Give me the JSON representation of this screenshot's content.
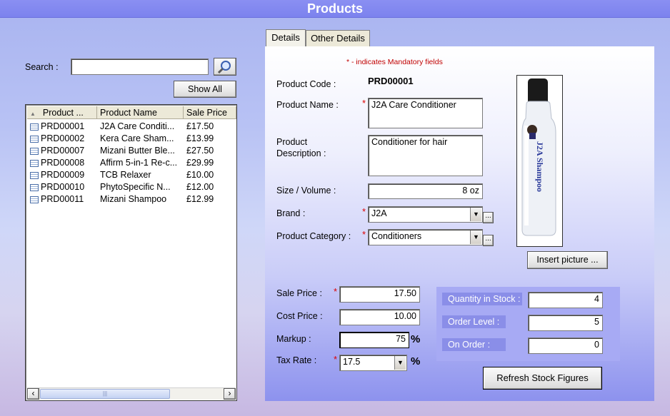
{
  "window": {
    "title": "Products"
  },
  "search": {
    "label": "Search :",
    "value": "",
    "show_all": "Show All"
  },
  "list": {
    "headers": [
      "Product ...",
      "Product Name",
      "Sale Price"
    ],
    "rows": [
      {
        "code": "PRD00001",
        "name": "J2A Care Conditi...",
        "price": "£17.50"
      },
      {
        "code": "PRD00002",
        "name": "Kera Care Sham...",
        "price": "£13.99"
      },
      {
        "code": "PRD00007",
        "name": "Mizani Butter Ble...",
        "price": "£27.50"
      },
      {
        "code": "PRD00008",
        "name": "Affirm 5-in-1 Re-c...",
        "price": "£29.99"
      },
      {
        "code": "PRD00009",
        "name": "TCB Relaxer",
        "price": "£10.00"
      },
      {
        "code": "PRD00010",
        "name": "PhytoSpecific N...",
        "price": "£12.00"
      },
      {
        "code": "PRD00011",
        "name": "Mizani Shampoo",
        "price": "£12.99"
      }
    ],
    "sort_glyph": "▲",
    "scroll_left": "‹",
    "scroll_right": "›",
    "scroll_grip": "|||"
  },
  "tabs": {
    "details": "Details",
    "other": "Other Details"
  },
  "form": {
    "mandatory_note": "* - indicates Mandatory fields",
    "required_mark": "*",
    "code_label": "Product Code :",
    "code_value": "PRD00001",
    "name_label": "Product Name :",
    "name_value": "J2A Care Conditioner",
    "desc_label_1": "Product",
    "desc_label_2": "Description :",
    "desc_value": "Conditioner for hair",
    "size_label": "Size / Volume :",
    "size_value": "8 oz",
    "brand_label": "Brand :",
    "brand_value": "J2A",
    "category_label": "Product Category :",
    "category_value": "Conditioners",
    "dots": "...",
    "combo_arrow": "▼",
    "insert_picture": "Insert picture ...",
    "bottle_text": "J2A Shampoo"
  },
  "pricing": {
    "sale_label": "Sale Price :",
    "sale_value": "17.50",
    "cost_label": "Cost Price :",
    "cost_value": "10.00",
    "markup_label": "Markup :",
    "markup_value": "75",
    "tax_label": "Tax Rate :",
    "tax_value": "17.5",
    "percent": "%"
  },
  "stock": {
    "qty_label": "Quantity in Stock :",
    "qty_value": "4",
    "order_label": "Order Level :",
    "order_value": "5",
    "on_order_label": "On Order :",
    "on_order_value": "0",
    "refresh": "Refresh Stock Figures"
  }
}
